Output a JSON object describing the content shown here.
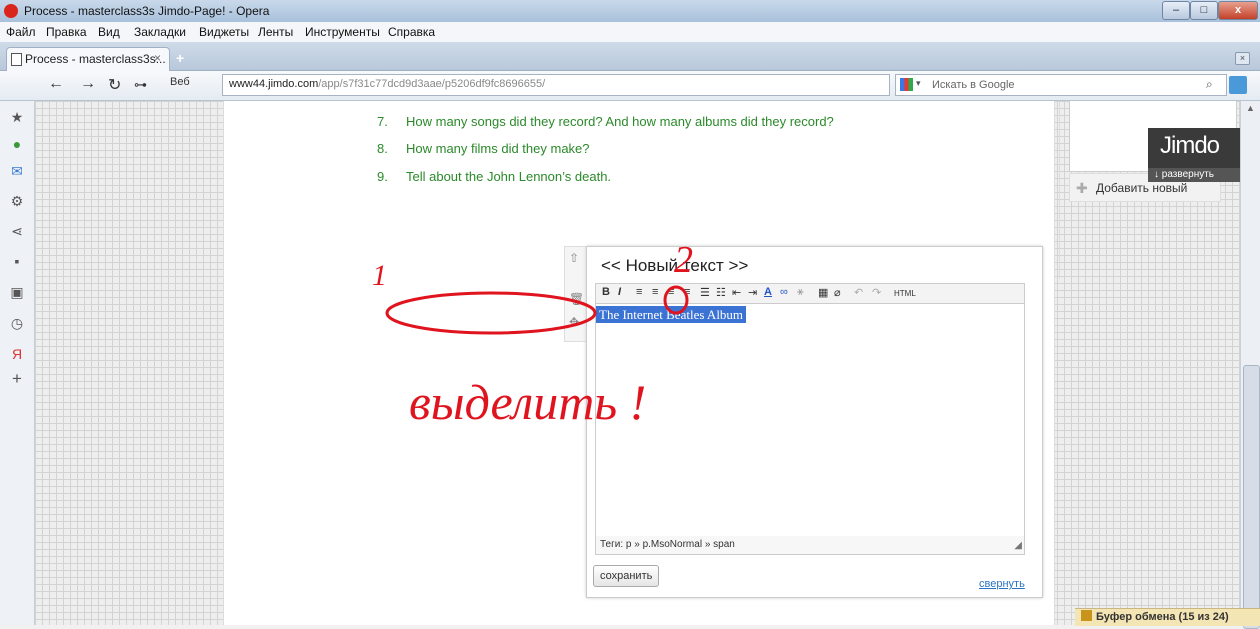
{
  "window": {
    "title": "Process - masterclass3s Jimdo-Page! - Opera",
    "minimize": "–",
    "maximize": "□",
    "close": "x"
  },
  "menu": [
    "Файл",
    "Правка",
    "Вид",
    "Закладки",
    "Виджеты",
    "Ленты",
    "Инструменты",
    "Справка"
  ],
  "tab": {
    "label": "Process - masterclass3s...",
    "close": "×",
    "new": "+"
  },
  "addressbar": {
    "security_label": "Веб",
    "url_host": "www44.jimdo.com",
    "url_path": "/app/s7f31c77dcd9d3aae/p5206df9fc8696655/",
    "search_placeholder": "Искать в Google"
  },
  "questions": [
    {
      "num": "7.",
      "text": "How many songs did they record? And how many albums did they record?"
    },
    {
      "num": "8.",
      "text": "How many films did they make?"
    },
    {
      "num": "9.",
      "text": "Tell about the John Lennon’s death."
    }
  ],
  "sidebar": {
    "add_new": "Добавить новый"
  },
  "editor": {
    "title": "<< Новый текст >>",
    "toolbar_html": "HTML",
    "selected_text": "The  Internet   Beatles   Album",
    "tags": "Теги: p » p.MsoNormal » span",
    "save": "сохранить",
    "collapse": "свернуть"
  },
  "annotations": {
    "num1": "1",
    "num2": "2",
    "handwriting": "выделить !",
    "color": "#e0141e"
  },
  "jimdo": {
    "logo": "Jimdo",
    "expand": "развернуть"
  },
  "statusbar": {
    "clipboard": "Буфер обмена (15 из 24)"
  }
}
